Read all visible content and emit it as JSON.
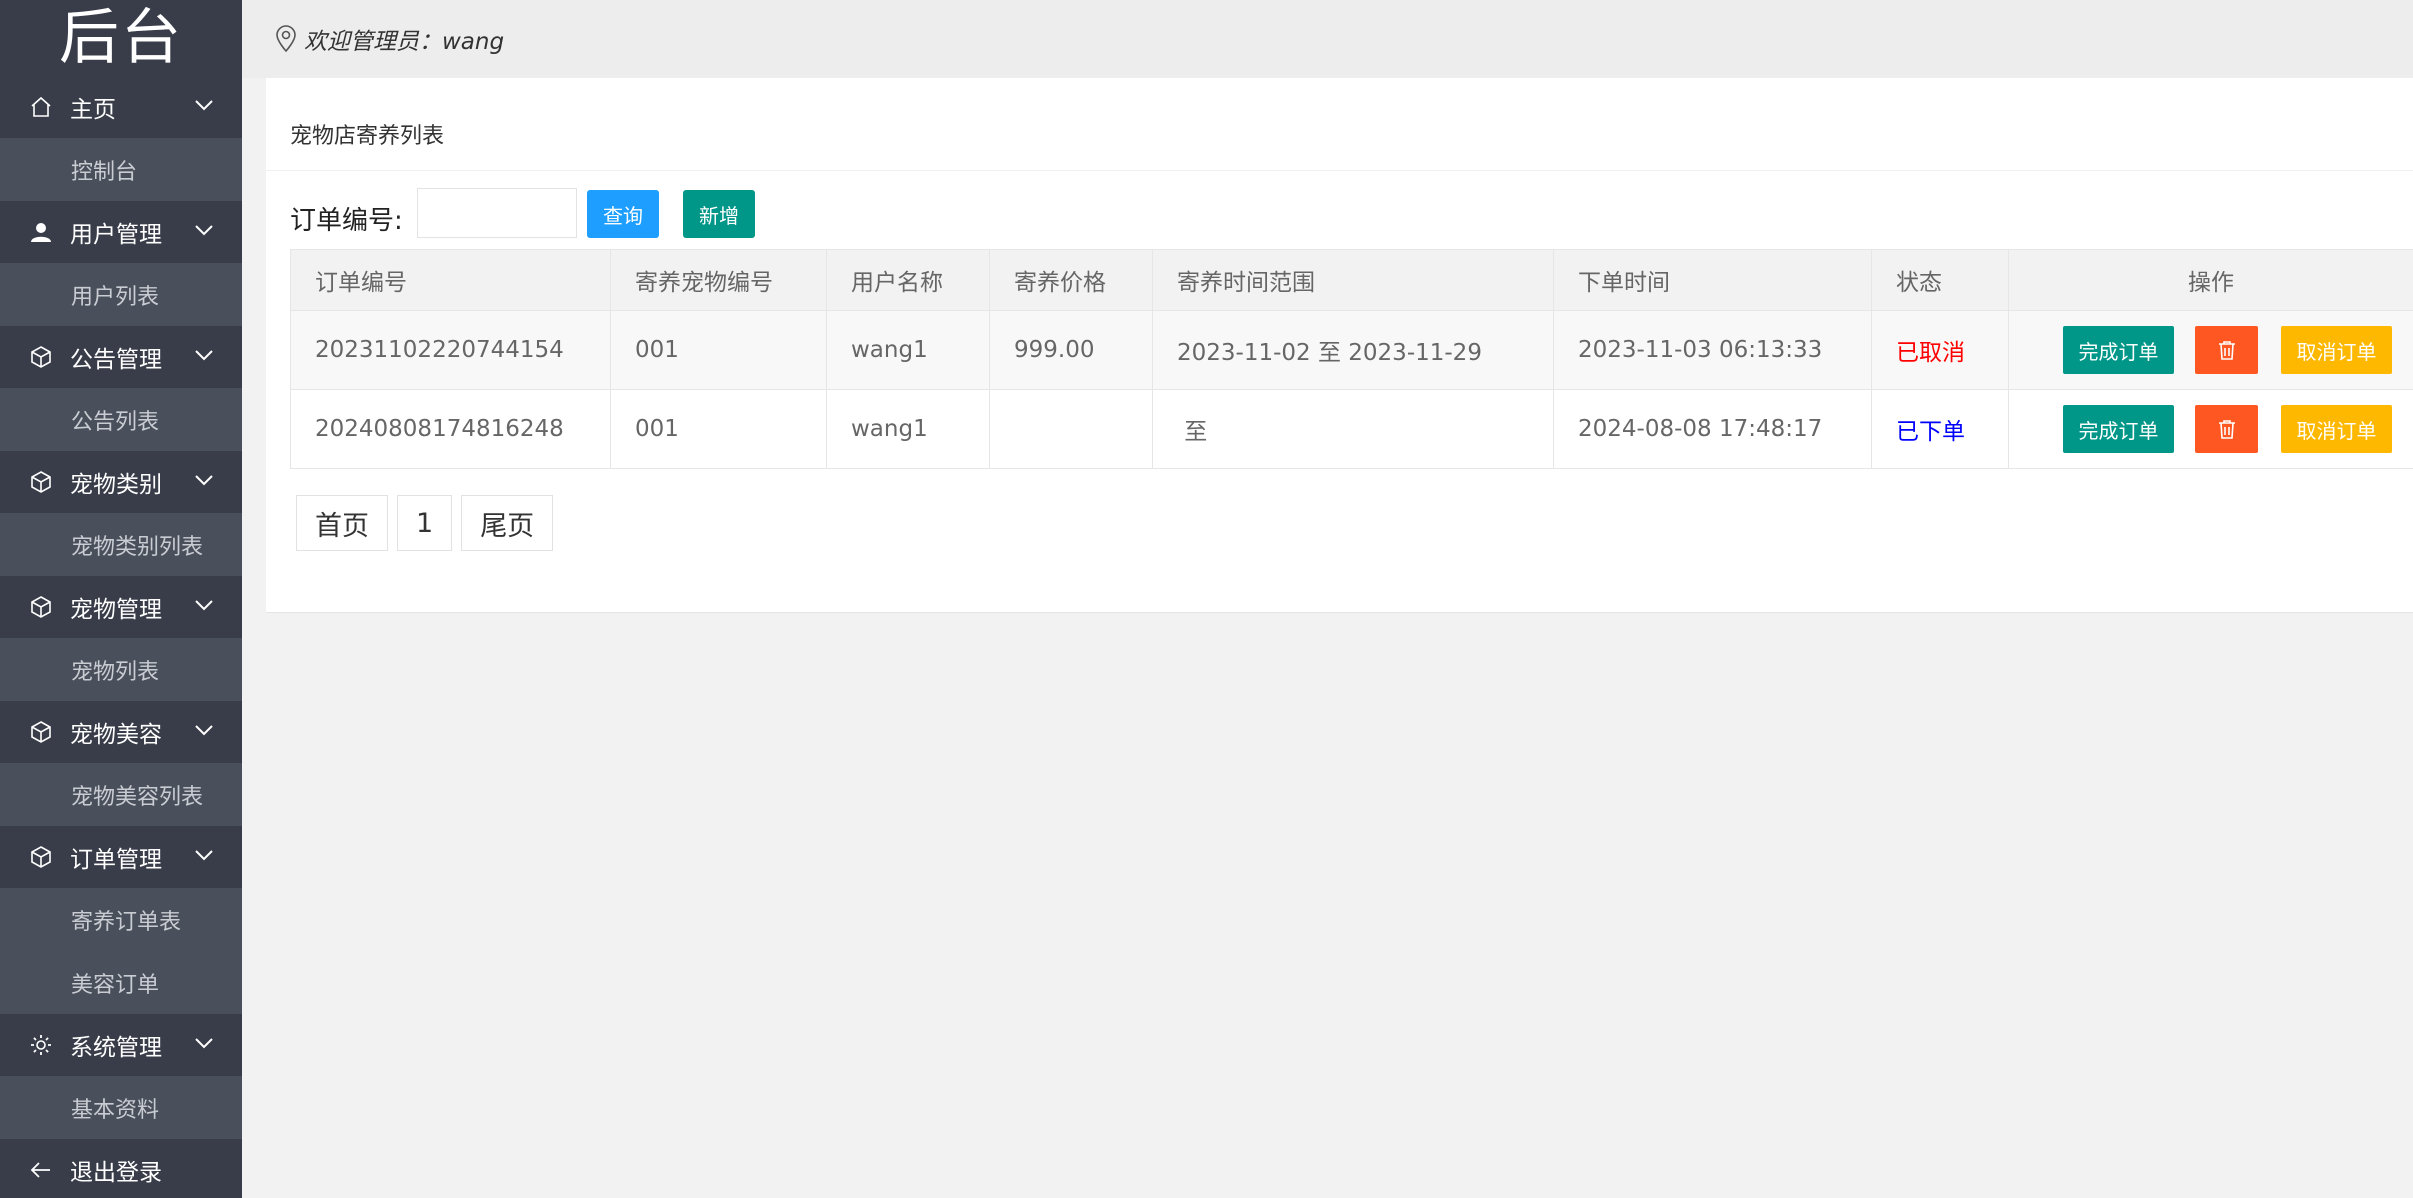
{
  "sidebar": {
    "logo": "后台",
    "groups": [
      {
        "label": "主页",
        "icon": "home-icon",
        "items": [
          "控制台"
        ]
      },
      {
        "label": "用户管理",
        "icon": "user-icon",
        "items": [
          "用户列表"
        ]
      },
      {
        "label": "公告管理",
        "icon": "cube-icon",
        "items": [
          "公告列表"
        ]
      },
      {
        "label": "宠物类别",
        "icon": "cube-icon",
        "items": [
          "宠物类别列表"
        ]
      },
      {
        "label": "宠物管理",
        "icon": "cube-icon",
        "items": [
          "宠物列表"
        ]
      },
      {
        "label": "宠物美容",
        "icon": "cube-icon",
        "items": [
          "宠物美容列表"
        ]
      },
      {
        "label": "订单管理",
        "icon": "cube-icon",
        "items": [
          "寄养订单表",
          "美容订单"
        ]
      },
      {
        "label": "系统管理",
        "icon": "gear-icon",
        "items": [
          "基本资料"
        ]
      }
    ],
    "logout": {
      "label": "退出登录",
      "icon": "arrow-left-icon"
    }
  },
  "header": {
    "welcome": "欢迎管理员：wang",
    "icon": "location-pin-icon"
  },
  "main": {
    "title": "宠物店寄养列表",
    "search": {
      "label": "订单编号:",
      "value": "",
      "placeholder": ""
    },
    "query_label": "查询",
    "add_label": "新增",
    "columns": [
      "订单编号",
      "寄养宠物编号",
      "用户名称",
      "寄养价格",
      "寄养时间范围",
      "下单时间",
      "状态",
      "操作"
    ],
    "rows": [
      {
        "order_no": "20231102220744154",
        "pet_no": "001",
        "user": "wang1",
        "price": "999.00",
        "range": "2023-11-02 至  2023-11-29",
        "created": "2023-11-03 06:13:33",
        "status": "已取消",
        "status_color": "#ff0000"
      },
      {
        "order_no": "20240808174816248",
        "pet_no": "001",
        "user": "wang1",
        "price": "",
        "range": " 至",
        "created": "2024-08-08 17:48:17",
        "status": "已下单",
        "status_color": "#0000ff"
      }
    ],
    "actions": {
      "complete": "完成订单",
      "delete_icon": "trash-icon",
      "cancel": "取消订单"
    },
    "pagination": {
      "first": "首页",
      "current": "1",
      "last": "尾页"
    }
  },
  "colors": {
    "sidebar_bg": "#393d49",
    "sub_bg": "#4a505b",
    "primary": "#009688",
    "blue": "#1e9fff",
    "danger": "#ff5722",
    "warm": "#ffb800"
  }
}
